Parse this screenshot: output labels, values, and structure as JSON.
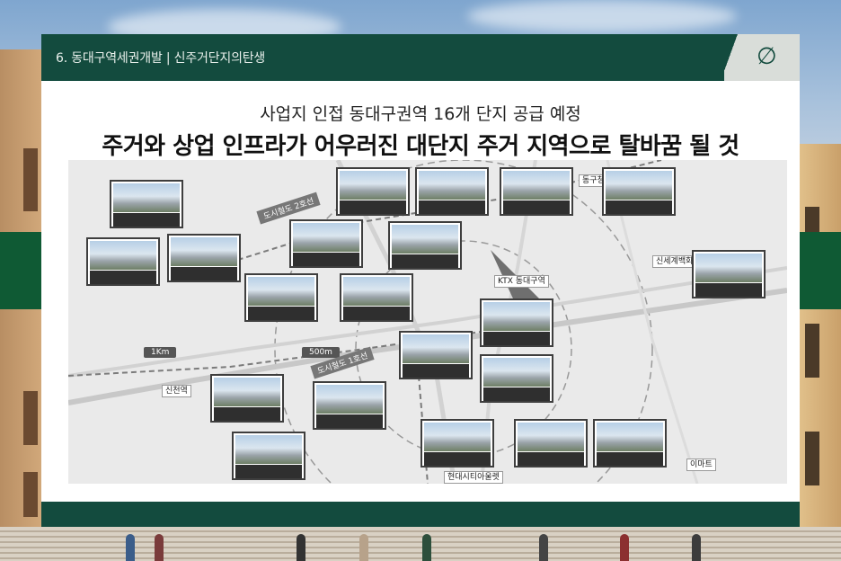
{
  "header": {
    "title": "6. 동대구역세권개발 | 신주거단지의탄생",
    "logo": "∅"
  },
  "subtitle": "사업지 인접 동대구권역 16개 단지 공급 예정",
  "headline": "주거와 상업 인프라가 어우러진 대단지 주거 지역으로 탈바꿈 될 것",
  "map": {
    "distances": [
      "1Km",
      "500m"
    ],
    "places": [
      {
        "label": "신천역"
      },
      {
        "label": "동구청역"
      },
      {
        "label": "KTX 동대구역"
      },
      {
        "label": "신세계백화점"
      },
      {
        "label": "이마트"
      },
      {
        "label": "현대시티아울렛"
      }
    ],
    "roads": [
      {
        "label": "도시철도 2호선"
      },
      {
        "label": "도시철도 1호선"
      }
    ],
    "projects": 23
  },
  "colors": {
    "header_bg": "#134b3e",
    "band": "#0f5a34"
  }
}
